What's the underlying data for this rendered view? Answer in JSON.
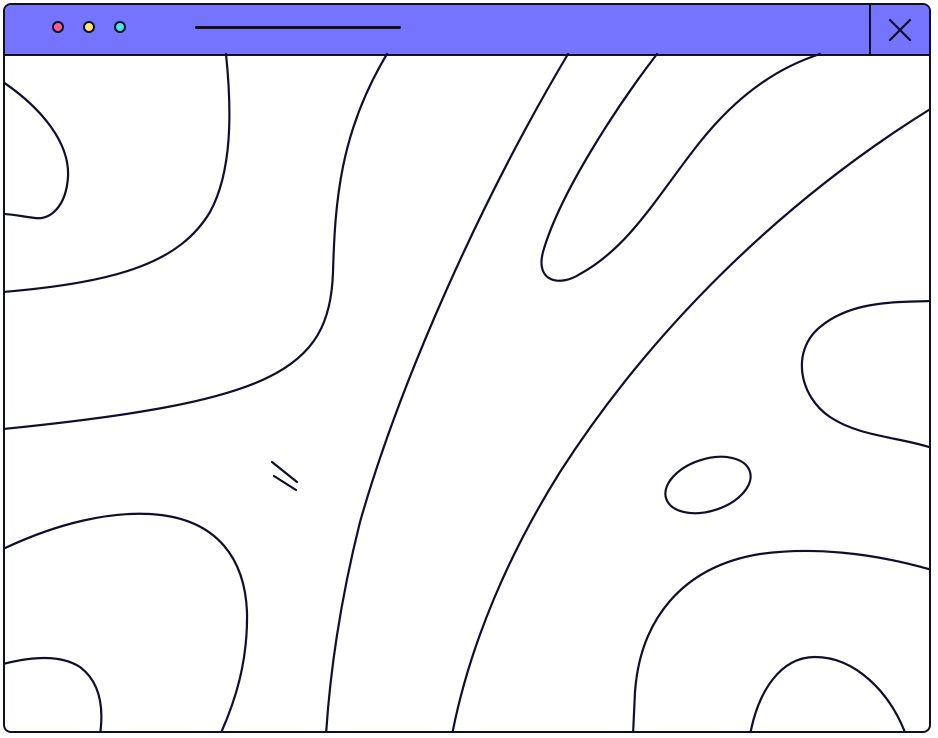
{
  "window": {
    "accent_color": "#7474ff",
    "outline_color": "#0f0f2d",
    "background_color": "#ffffff",
    "traffic_lights": [
      {
        "name": "close-dot",
        "color": "#ff5d8f"
      },
      {
        "name": "minimize-dot",
        "color": "#ffe66d"
      },
      {
        "name": "maximize-dot",
        "color": "#4de3e0"
      }
    ],
    "close_icon": "close-icon"
  },
  "content": {
    "illustration": "topographic-contour-lines"
  }
}
